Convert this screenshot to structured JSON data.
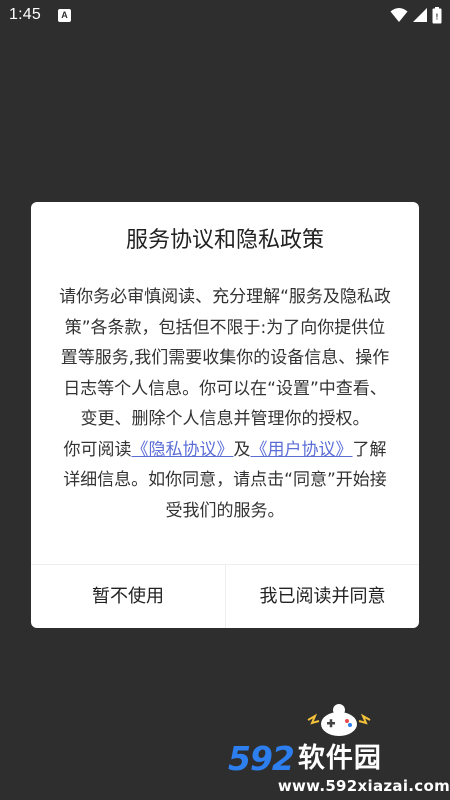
{
  "status_bar": {
    "time": "1:45",
    "notification_icon": "A",
    "icons": [
      "wifi-icon",
      "signal-icon",
      "battery-icon"
    ]
  },
  "dialog": {
    "title": "服务协议和隐私政策",
    "body": {
      "para1": "请你务必审慎阅读、充分理解“服务及隐私政策”各条款，包括但不限于:为了向你提供位置等服务,我们需要收集你的设备信息、操作日志等个人信息。你可以在“设置”中查看、变更、删除个人信息并管理你的授权。",
      "para2_prefix": "你可阅读",
      "privacy_link": "《隐私协议》",
      "conjunction": "及",
      "user_agreement_link": "《用户协议》",
      "para2_suffix": "了解详细信息。如你同意，请点击“同意”开始接受我们的服务。"
    },
    "buttons": {
      "decline": "暂不使用",
      "agree": "我已阅读并同意"
    }
  },
  "watermark": {
    "number": "592",
    "name": "软件园",
    "url": "www.592xiazai.com"
  },
  "colors": {
    "background": "#2e2e2e",
    "link": "#5b6ed6",
    "watermark_number": "#2d7ff0"
  }
}
